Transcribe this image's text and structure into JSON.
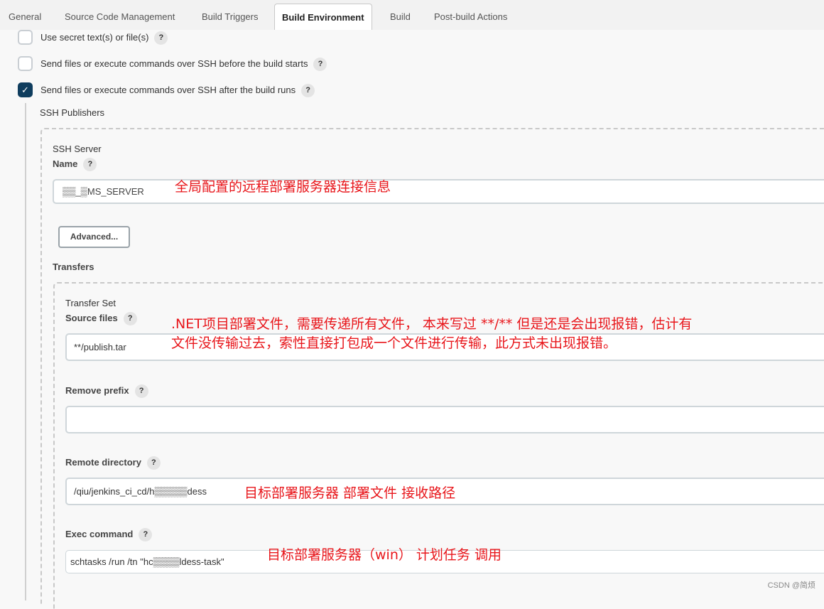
{
  "tabs": [
    "General",
    "Source Code Management",
    "Build Triggers",
    "Build Environment",
    "Build",
    "Post-build Actions"
  ],
  "active_tab": "Build Environment",
  "options": [
    {
      "label": "Use secret text(s) or file(s)",
      "checked": false
    },
    {
      "label": "Send files or execute commands over SSH before the build starts",
      "checked": false
    },
    {
      "label": "Send files or execute commands over SSH after the build runs",
      "checked": true
    }
  ],
  "help": "?",
  "check": "✓",
  "ssh_publishers": "SSH Publishers",
  "ssh_server": {
    "title": "SSH Server",
    "name_label": "Name",
    "name_value": "▒▒_▒MS_SERVER",
    "advanced": "Advanced..."
  },
  "transfers": "Transfers",
  "transfer_set": {
    "title": "Transfer Set",
    "source_files_label": "Source files",
    "source_files": "**/publish.tar",
    "remove_prefix_label": "Remove prefix",
    "remove_prefix": "",
    "remote_directory_label": "Remote directory",
    "remote_directory": "/qiu/jenkins_ci_cd/h▒▒▒▒▒dess",
    "exec_command_label": "Exec command",
    "exec_command": "schtasks /run /tn \"hc▒▒▒▒ldess-task\""
  },
  "annotations": {
    "server": "全局配置的远程部署服务器连接信息",
    "source1": ".NET项目部署文件，需要传递所有文件， 本来写过 **/** 但是还是会出现报错，估计有",
    "source2": "文件没传输过去，索性直接打包成一个文件进行传输，此方式未出现报错。",
    "remote": "目标部署服务器 部署文件 接收路径",
    "exec": "目标部署服务器（win） 计划任务 调用"
  },
  "watermark": "CSDN @简烦"
}
